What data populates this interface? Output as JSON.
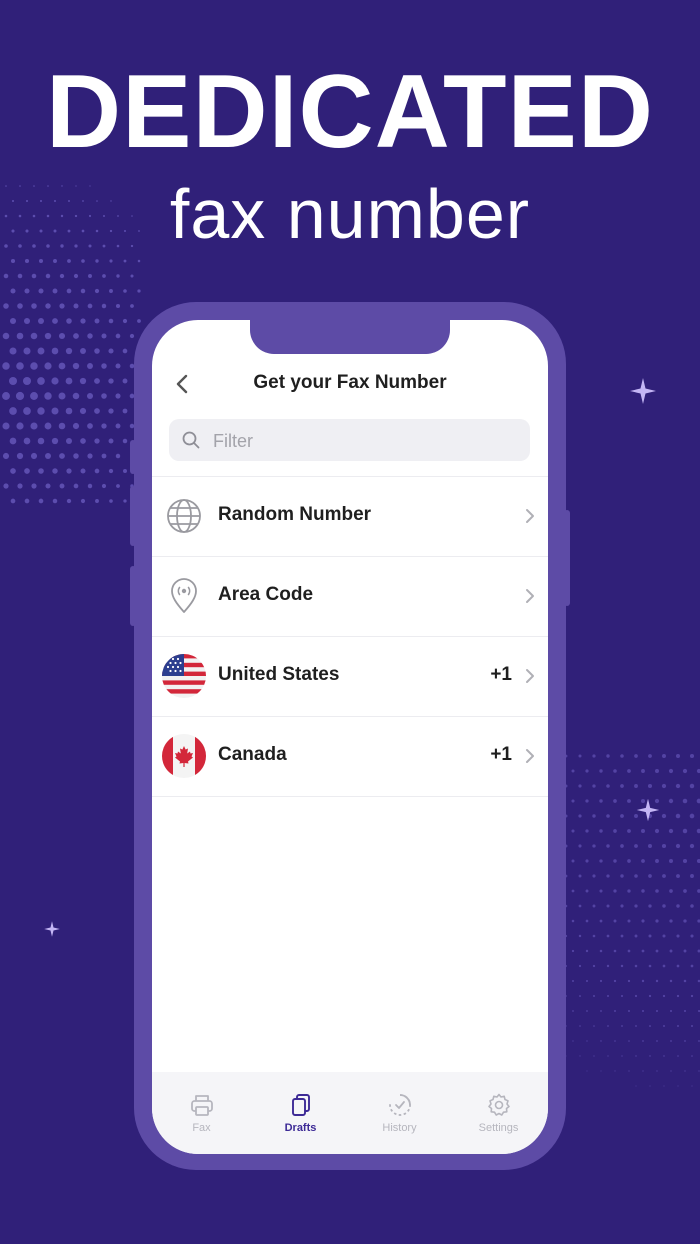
{
  "headline": {
    "line1": "DEDICATED",
    "line2": "fax number"
  },
  "colors": {
    "background": "#302079",
    "phone_frame": "#5d4ba6",
    "accent": "#3d2a96",
    "inactive_tab": "#b6b6be"
  },
  "screen": {
    "nav": {
      "back_icon": "chevron-left-icon",
      "title": "Get your Fax Number"
    },
    "search": {
      "placeholder": "Filter",
      "value": "",
      "icon": "search-icon"
    },
    "list": [
      {
        "icon": "globe-icon",
        "label": "Random Number",
        "code": ""
      },
      {
        "icon": "location-pin-icon",
        "label": "Area Code",
        "code": ""
      },
      {
        "icon": "us-flag-icon",
        "label": "United States",
        "code": "+1"
      },
      {
        "icon": "canada-flag-icon",
        "label": "Canada",
        "code": "+1"
      }
    ],
    "tabbar": [
      {
        "icon": "printer-icon",
        "label": "Fax",
        "active": false
      },
      {
        "icon": "documents-icon",
        "label": "Drafts",
        "active": true
      },
      {
        "icon": "history-icon",
        "label": "History",
        "active": false
      },
      {
        "icon": "gear-icon",
        "label": "Settings",
        "active": false
      }
    ]
  }
}
